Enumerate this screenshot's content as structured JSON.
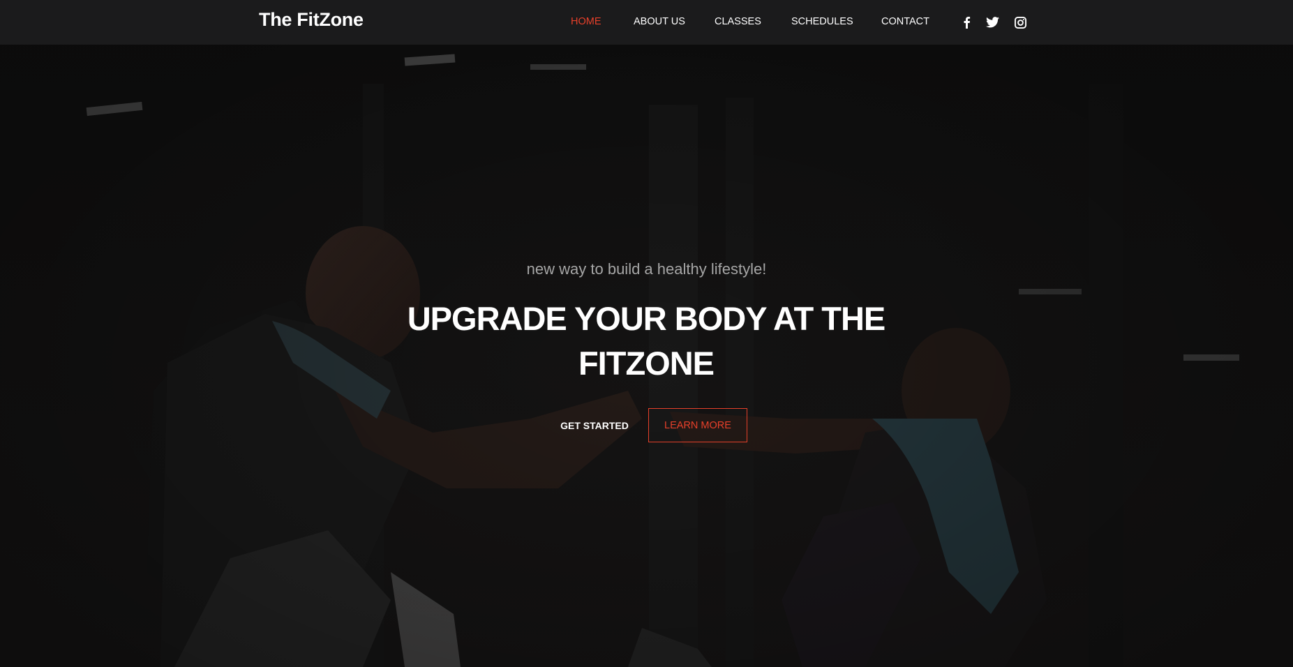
{
  "brand": {
    "logo": "The FitZone"
  },
  "nav": {
    "items": [
      {
        "label": "HOME",
        "active": true
      },
      {
        "label": "ABOUT US",
        "active": false
      },
      {
        "label": "CLASSES",
        "active": false
      },
      {
        "label": "SCHEDULES",
        "active": false
      },
      {
        "label": "CONTACT",
        "active": false
      }
    ],
    "social": [
      "facebook-icon",
      "twitter-icon",
      "instagram-icon"
    ]
  },
  "hero": {
    "subtitle": "new way to build a healthy lifestyle!",
    "title": "UPGRADE YOUR BODY AT THE FITZONE",
    "primary_button": "GET STARTED",
    "secondary_button": "LEARN MORE"
  },
  "colors": {
    "accent": "#e8402a",
    "navbar_bg": "#1b1b1c",
    "text": "#ffffff",
    "subtitle": "#a6a6a6"
  }
}
